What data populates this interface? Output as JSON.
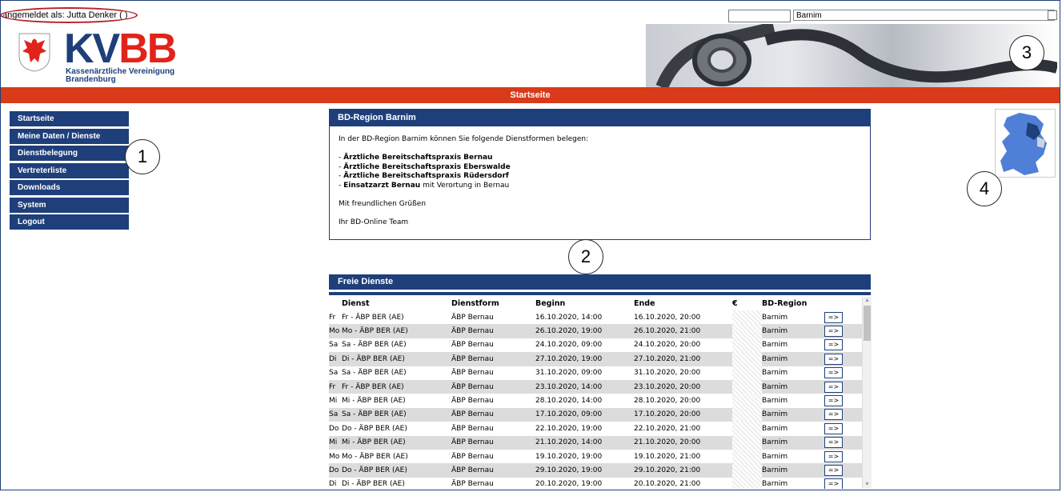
{
  "login": {
    "text": "angemeldet als: Jutta Denker ( )"
  },
  "region_select": {
    "value": "Barnim"
  },
  "logo": {
    "kv": "KV",
    "bb": "BB",
    "line1": "Kassenärztliche Vereinigung",
    "line2": "Brandenburg"
  },
  "nav": {
    "title": "Startseite"
  },
  "sidebar": {
    "items": [
      {
        "label": "Startseite"
      },
      {
        "label": "Meine Daten / Dienste"
      },
      {
        "label": "Dienstbelegung"
      },
      {
        "label": "Vertreterliste"
      },
      {
        "label": "Downloads"
      },
      {
        "label": "System"
      },
      {
        "label": "Logout"
      }
    ]
  },
  "info": {
    "title": "BD-Region Barnim",
    "intro": "In der BD-Region Barnim können Sie folgende Dienstformen belegen:",
    "items": [
      {
        "bold": "Ärztliche Bereitschaftspraxis Bernau",
        "rest": ""
      },
      {
        "bold": "Ärztliche Bereitschaftspraxis Eberswalde",
        "rest": ""
      },
      {
        "bold": "Ärztliche Bereitschaftspraxis Rüdersdorf",
        "rest": ""
      },
      {
        "bold": "Einsatzarzt Bernau",
        "rest": " mit Verortung in Bernau"
      }
    ],
    "greeting": "Mit freundlichen Grüßen",
    "team": "Ihr BD-Online Team"
  },
  "free_services": {
    "title": "Freie Dienste",
    "columns": {
      "dienst": "Dienst",
      "dienstform": "Dienstform",
      "beginn": "Beginn",
      "ende": "Ende",
      "price": "€",
      "region": "BD-Region"
    },
    "button_label": "=>",
    "rows": [
      {
        "day": "Fr",
        "dienst": "Fr - ÄBP BER (AE)",
        "form": "ÄBP Bernau",
        "begin": "16.10.2020, 14:00",
        "end": "16.10.2020, 20:00",
        "region": "Barnim"
      },
      {
        "day": "Mo",
        "dienst": "Mo - ÄBP BER (AE)",
        "form": "ÄBP Bernau",
        "begin": "26.10.2020, 19:00",
        "end": "26.10.2020, 21:00",
        "region": "Barnim"
      },
      {
        "day": "Sa",
        "dienst": "Sa - ÄBP BER (AE)",
        "form": "ÄBP Bernau",
        "begin": "24.10.2020, 09:00",
        "end": "24.10.2020, 20:00",
        "region": "Barnim"
      },
      {
        "day": "Di",
        "dienst": "Di - ÄBP BER (AE)",
        "form": "ÄBP Bernau",
        "begin": "27.10.2020, 19:00",
        "end": "27.10.2020, 21:00",
        "region": "Barnim"
      },
      {
        "day": "Sa",
        "dienst": "Sa - ÄBP BER (AE)",
        "form": "ÄBP Bernau",
        "begin": "31.10.2020, 09:00",
        "end": "31.10.2020, 20:00",
        "region": "Barnim"
      },
      {
        "day": "Fr",
        "dienst": "Fr - ÄBP BER (AE)",
        "form": "ÄBP Bernau",
        "begin": "23.10.2020, 14:00",
        "end": "23.10.2020, 20:00",
        "region": "Barnim"
      },
      {
        "day": "Mi",
        "dienst": "Mi - ÄBP BER (AE)",
        "form": "ÄBP Bernau",
        "begin": "28.10.2020, 14:00",
        "end": "28.10.2020, 20:00",
        "region": "Barnim"
      },
      {
        "day": "Sa",
        "dienst": "Sa - ÄBP BER (AE)",
        "form": "ÄBP Bernau",
        "begin": "17.10.2020, 09:00",
        "end": "17.10.2020, 20:00",
        "region": "Barnim"
      },
      {
        "day": "Do",
        "dienst": "Do - ÄBP BER (AE)",
        "form": "ÄBP Bernau",
        "begin": "22.10.2020, 19:00",
        "end": "22.10.2020, 21:00",
        "region": "Barnim"
      },
      {
        "day": "Mi",
        "dienst": "Mi - ÄBP BER (AE)",
        "form": "ÄBP Bernau",
        "begin": "21.10.2020, 14:00",
        "end": "21.10.2020, 20:00",
        "region": "Barnim"
      },
      {
        "day": "Mo",
        "dienst": "Mo - ÄBP BER (AE)",
        "form": "ÄBP Bernau",
        "begin": "19.10.2020, 19:00",
        "end": "19.10.2020, 21:00",
        "region": "Barnim"
      },
      {
        "day": "Do",
        "dienst": "Do - ÄBP BER (AE)",
        "form": "ÄBP Bernau",
        "begin": "29.10.2020, 19:00",
        "end": "29.10.2020, 21:00",
        "region": "Barnim"
      },
      {
        "day": "Di",
        "dienst": "Di - ÄBP BER (AE)",
        "form": "ÄBP Bernau",
        "begin": "20.10.2020, 19:00",
        "end": "20.10.2020, 21:00",
        "region": "Barnim"
      }
    ]
  },
  "callouts": [
    "1",
    "2",
    "3",
    "4"
  ],
  "colors": {
    "primary": "#1f3f7a",
    "accent": "#d93a1a",
    "logo_red": "#e2231a",
    "oval": "#b8232b"
  }
}
